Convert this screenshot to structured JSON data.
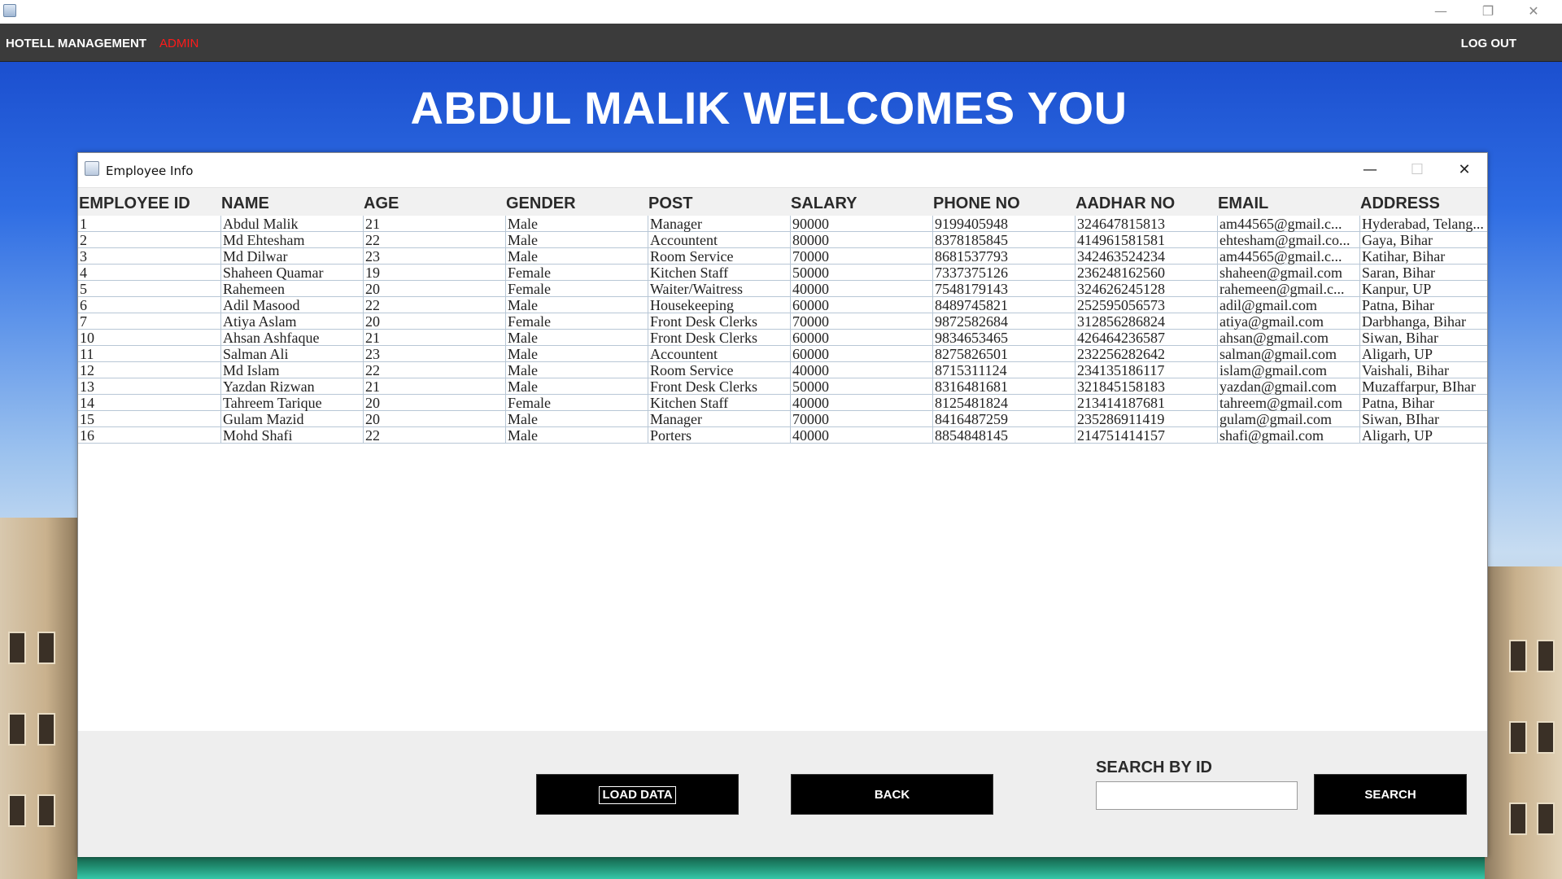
{
  "window": {
    "min": "—",
    "restore": "❐",
    "close": "✕"
  },
  "header": {
    "title": "HOTELL MANAGEMENT",
    "role": "ADMIN",
    "logout": "LOG OUT"
  },
  "welcome": "ABDUL MALIK WELCOMES YOU",
  "frame": {
    "title": "Employee Info",
    "min": "—",
    "max": "☐",
    "close": "✕"
  },
  "table": {
    "columns": [
      "EMPLOYEE ID",
      "NAME",
      "AGE",
      "GENDER",
      "POST",
      "SALARY",
      "PHONE NO",
      "AADHAR NO",
      "EMAIL",
      "ADDRESS"
    ],
    "rows": [
      [
        "1",
        "Abdul Malik",
        "21",
        "Male",
        "Manager",
        "90000",
        "9199405948",
        "324647815813",
        "am44565@gmail.c...",
        "Hyderabad, Telang..."
      ],
      [
        "2",
        "Md Ehtesham",
        "22",
        "Male",
        "Accountent",
        "80000",
        "8378185845",
        "414961581581",
        "ehtesham@gmail.co...",
        "Gaya, Bihar"
      ],
      [
        "3",
        "Md Dilwar",
        "23",
        "Male",
        "Room Service",
        "70000",
        "8681537793",
        "342463524234",
        "am44565@gmail.c...",
        "Katihar, Bihar"
      ],
      [
        "4",
        "Shaheen Quamar",
        "19",
        "Female",
        "Kitchen Staff",
        "50000",
        "7337375126",
        "236248162560",
        "shaheen@gmail.com",
        "Saran, Bihar"
      ],
      [
        "5",
        "Rahemeen",
        "20",
        "Female",
        "Waiter/Waitress",
        "40000",
        "7548179143",
        "324626245128",
        "rahemeen@gmail.c...",
        "Kanpur, UP"
      ],
      [
        "6",
        "Adil Masood",
        "22",
        "Male",
        "Housekeeping",
        "60000",
        "8489745821",
        "252595056573",
        "adil@gmail.com",
        "Patna, Bihar"
      ],
      [
        "7",
        "Atiya Aslam",
        "20",
        "Female",
        "Front Desk Clerks",
        "70000",
        "9872582684",
        "312856286824",
        "atiya@gmail.com",
        "Darbhanga, Bihar"
      ],
      [
        "10",
        "Ahsan Ashfaque",
        "21",
        "Male",
        "Front Desk Clerks",
        "60000",
        "9834653465",
        "426464236587",
        "ahsan@gmail.com",
        "Siwan, Bihar"
      ],
      [
        "11",
        "Salman Ali",
        "23",
        "Male",
        "Accountent",
        "60000",
        "8275826501",
        "232256282642",
        "salman@gmail.com",
        "Aligarh, UP"
      ],
      [
        "12",
        "Md Islam",
        "22",
        "Male",
        "Room Service",
        "40000",
        "8715311124",
        "234135186117",
        "islam@gmail.com",
        "Vaishali, Bihar"
      ],
      [
        "13",
        "Yazdan Rizwan",
        "21",
        "Male",
        "Front Desk Clerks",
        "50000",
        "8316481681",
        "321845158183",
        "yazdan@gmail.com",
        "Muzaffarpur, BIhar"
      ],
      [
        "14",
        "Tahreem Tarique",
        "20",
        "Female",
        "Kitchen Staff",
        "40000",
        "8125481824",
        "213414187681",
        "tahreem@gmail.com",
        "Patna, Bihar"
      ],
      [
        "15",
        "Gulam Mazid",
        "20",
        "Male",
        "Manager",
        "70000",
        "8416487259",
        "235286911419",
        "gulam@gmail.com",
        "Siwan, BIhar"
      ],
      [
        "16",
        "Mohd Shafi",
        "22",
        "Male",
        "Porters",
        "40000",
        "8854848145",
        "214751414157",
        "shafi@gmail.com",
        "Aligarh, UP"
      ]
    ]
  },
  "buttons": {
    "load": "LOAD DATA",
    "back": "BACK",
    "search": "SEARCH"
  },
  "search": {
    "label": "SEARCH BY ID",
    "value": ""
  }
}
